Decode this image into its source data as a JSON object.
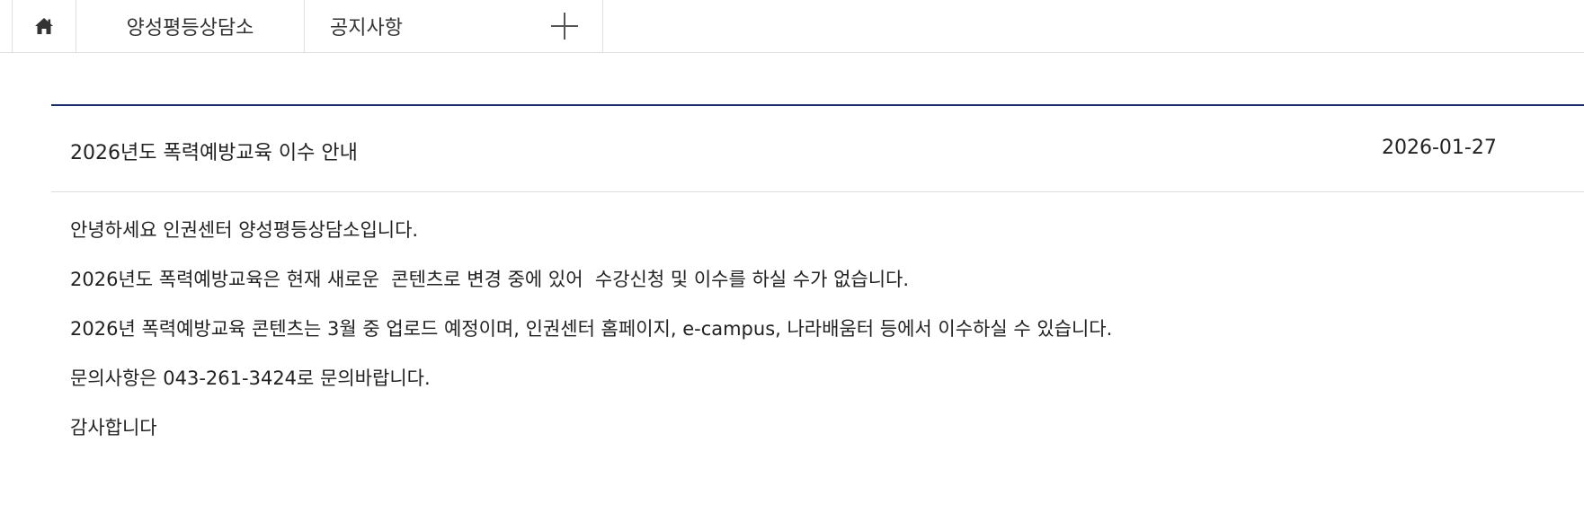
{
  "breadcrumb": {
    "home_icon": "home-icon",
    "section_label": "양성평등상담소",
    "board_label": "공지사항",
    "more_icon": "plus-icon"
  },
  "post": {
    "title": "2026년도 폭력예방교육 이수 안내",
    "date": "2026-01-27",
    "body": [
      "안녕하세요 인권센터 양성평등상담소입니다.",
      "2026년도 폭력예방교육은 현재 새로운  콘텐츠로 변경 중에 있어  수강신청 및 이수를 하실 수가 없습니다.",
      "2026년 폭력예방교육 콘텐츠는 3월 중 업로드 예정이며, 인권센터 홈페이지, e-campus, 나라배움터 등에서 이수하실 수 있습니다.",
      "문의사항은 043-261-3424로 문의바랍니다.",
      "감사합니다"
    ]
  },
  "colors": {
    "accent": "#1c2d6b",
    "border": "#e0e0e0",
    "text": "#222222"
  }
}
